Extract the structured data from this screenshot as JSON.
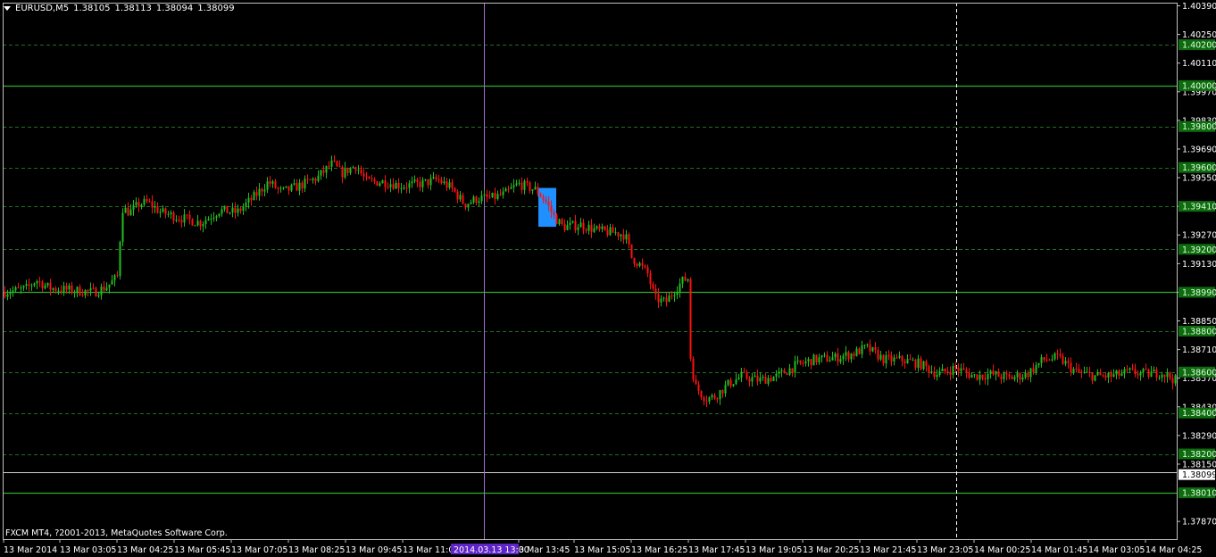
{
  "header": {
    "symbol": "EURUSD,M5",
    "open": "1.38105",
    "high": "1.38113",
    "low": "1.38094",
    "close": "1.38099"
  },
  "copyright": "FXCM MT4, ?2001-2013, MetaQuotes Software Corp.",
  "colors": {
    "background": "#000000",
    "axis": "#c0c0c0",
    "grid": "#1f6f1f",
    "level_line": "#2eaa2e",
    "level_label_bg": "#0f6b0f",
    "bull": "#1fbf1f",
    "bear": "#ff1010",
    "vline": "#a070d0",
    "marker": "#5f24c7",
    "highlight": "#1e90ff",
    "bid_label_bg": "#ffffff"
  },
  "chart_data": {
    "type": "candlestick",
    "ylim": [
      1.3779,
      1.4039
    ],
    "price_scale_labels": [
      "1.40390",
      "1.40250",
      "1.40110",
      "1.39970",
      "1.39830",
      "1.39690",
      "1.39550",
      "1.39410",
      "1.39270",
      "1.39130",
      "1.38990",
      "1.38850",
      "1.38710",
      "1.38570",
      "1.38430",
      "1.38290",
      "1.38150",
      "1.37870"
    ],
    "grid_levels": [
      1.402,
      1.398,
      1.396,
      1.3941,
      1.392,
      1.388,
      1.386,
      1.384,
      1.382
    ],
    "grid_level_labels": [
      "1.40200",
      "1.39800",
      "1.39600",
      "1.39410",
      "1.39200",
      "1.38800",
      "1.38600",
      "1.38400",
      "1.38200"
    ],
    "solid_levels": [
      1.4,
      1.3899,
      1.3801
    ],
    "solid_level_labels": [
      "1.40000",
      "1.38990",
      "1.38010"
    ],
    "current_bid": 1.38099,
    "current_bid_label": "1.38099",
    "white_hline": 1.3811,
    "time_labels": [
      "13 Mar 2014",
      "13 Mar 03:05",
      "13 Mar 04:25",
      "13 Mar 05:45",
      "13 Mar 07:05",
      "13 Mar 08:25",
      "13 Mar 09:45",
      "13 Mar 11:05",
      "3 Mar 13:45",
      "13 Mar 15:05",
      "13 Mar 16:25",
      "13 Mar 17:45",
      "13 Mar 19:05",
      "13 Mar 20:25",
      "13 Mar 21:45",
      "13 Mar 23:05",
      "14 Mar 00:25",
      "14 Mar 01:45",
      "14 Mar 03:05",
      "14 Mar 04:25"
    ],
    "cursor_time_label": "2014.03.13 13:00",
    "path": [
      [
        0,
        1.3899
      ],
      [
        20,
        1.39
      ],
      [
        30,
        1.3901
      ],
      [
        40,
        1.3905
      ],
      [
        55,
        1.3901
      ],
      [
        80,
        1.39
      ],
      [
        105,
        1.3899
      ],
      [
        120,
        1.3902
      ],
      [
        132,
        1.3907
      ],
      [
        134,
        1.3925
      ],
      [
        137,
        1.394
      ],
      [
        145,
        1.3938
      ],
      [
        155,
        1.3942
      ],
      [
        165,
        1.3943
      ],
      [
        180,
        1.3938
      ],
      [
        205,
        1.3935
      ],
      [
        225,
        1.3933
      ],
      [
        245,
        1.3939
      ],
      [
        265,
        1.3938
      ],
      [
        285,
        1.3946
      ],
      [
        300,
        1.3953
      ],
      [
        315,
        1.3948
      ],
      [
        335,
        1.3951
      ],
      [
        355,
        1.3955
      ],
      [
        372,
        1.3962
      ],
      [
        382,
        1.3957
      ],
      [
        398,
        1.3961
      ],
      [
        410,
        1.3953
      ],
      [
        430,
        1.3953
      ],
      [
        450,
        1.3951
      ],
      [
        470,
        1.3952
      ],
      [
        490,
        1.3954
      ],
      [
        505,
        1.395
      ],
      [
        520,
        1.3942
      ],
      [
        535,
        1.3945
      ],
      [
        550,
        1.3945
      ],
      [
        565,
        1.3947
      ],
      [
        580,
        1.3952
      ],
      [
        600,
        1.3949
      ],
      [
        610,
        1.3944
      ],
      [
        620,
        1.3936
      ],
      [
        630,
        1.3931
      ],
      [
        650,
        1.3932
      ],
      [
        670,
        1.3929
      ],
      [
        690,
        1.3928
      ],
      [
        700,
        1.3927
      ],
      [
        707,
        1.3916
      ],
      [
        715,
        1.3913
      ],
      [
        725,
        1.3908
      ],
      [
        733,
        1.3896
      ],
      [
        745,
        1.3894
      ],
      [
        755,
        1.39
      ],
      [
        765,
        1.3905
      ],
      [
        771,
        1.3906
      ],
      [
        772,
        1.387
      ],
      [
        778,
        1.3853
      ],
      [
        790,
        1.3847
      ],
      [
        800,
        1.3848
      ],
      [
        815,
        1.3854
      ],
      [
        830,
        1.3858
      ],
      [
        850,
        1.3856
      ],
      [
        870,
        1.3858
      ],
      [
        890,
        1.3863
      ],
      [
        910,
        1.3866
      ],
      [
        935,
        1.3867
      ],
      [
        955,
        1.3869
      ],
      [
        970,
        1.3872
      ],
      [
        990,
        1.3866
      ],
      [
        1010,
        1.3866
      ],
      [
        1030,
        1.3864
      ],
      [
        1050,
        1.3859
      ],
      [
        1070,
        1.3862
      ],
      [
        1090,
        1.3858
      ],
      [
        1110,
        1.3859
      ],
      [
        1130,
        1.3857
      ],
      [
        1150,
        1.3859
      ],
      [
        1168,
        1.3866
      ],
      [
        1185,
        1.3867
      ],
      [
        1205,
        1.386
      ],
      [
        1225,
        1.3858
      ],
      [
        1245,
        1.3858
      ],
      [
        1265,
        1.386
      ],
      [
        1285,
        1.3859
      ],
      [
        1300,
        1.386
      ],
      [
        1316,
        1.3856
      ]
    ]
  }
}
